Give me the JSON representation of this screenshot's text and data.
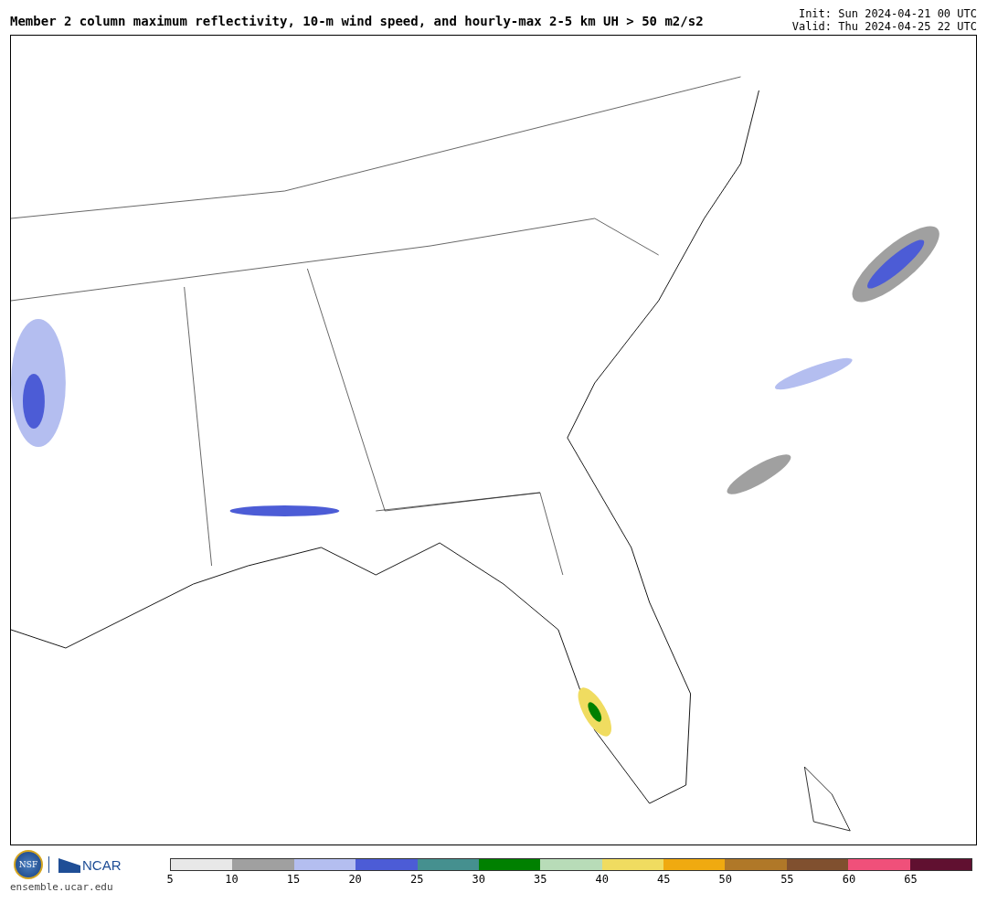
{
  "title": "Member 2 column maximum reflectivity, 10-m wind speed, and hourly-max 2-5 km UH > 50 m2/s2",
  "init": "Init: Sun 2024-04-21 00 UTC",
  "valid": "Valid: Thu 2024-04-25 22 UTC",
  "logos": {
    "nsf": "NSF",
    "ncar": "NCAR",
    "url": "ensemble.ucar.edu"
  },
  "colorbar": {
    "bins": [
      {
        "label": "5",
        "color": "#e8e8e8"
      },
      {
        "label": "10",
        "color": "#a0a0a0"
      },
      {
        "label": "15",
        "color": "#b4bef0"
      },
      {
        "label": "20",
        "color": "#4c5cd6"
      },
      {
        "label": "25",
        "color": "#45908f"
      },
      {
        "label": "30",
        "color": "#008000"
      },
      {
        "label": "35",
        "color": "#b8dcb8"
      },
      {
        "label": "40",
        "color": "#f0dc60"
      },
      {
        "label": "45",
        "color": "#f0aa10"
      },
      {
        "label": "50",
        "color": "#b07828"
      },
      {
        "label": "55",
        "color": "#80502f"
      },
      {
        "label": "60",
        "color": "#f0507a"
      },
      {
        "label": "65",
        "color": "#601030"
      }
    ]
  }
}
